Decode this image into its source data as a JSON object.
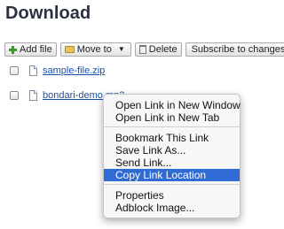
{
  "page": {
    "title": "Download"
  },
  "toolbar": {
    "add_file": "Add file",
    "move_to": "Move to",
    "delete": "Delete",
    "subscribe": "Subscribe to changes"
  },
  "files": [
    {
      "name": "sample-file.zip"
    },
    {
      "name": "bondari-demo.mp3"
    }
  ],
  "context_menu": {
    "groups": [
      [
        "Open Link in New Window",
        "Open Link in New Tab"
      ],
      [
        "Bookmark This Link",
        "Save Link As...",
        "Send Link...",
        "Copy Link Location"
      ],
      [
        "Properties",
        "Adblock Image..."
      ]
    ],
    "highlighted": "Copy Link Location"
  },
  "colors": {
    "link": "#1a4fa8",
    "highlight": "#2f6bd3",
    "title": "#2a3140"
  }
}
